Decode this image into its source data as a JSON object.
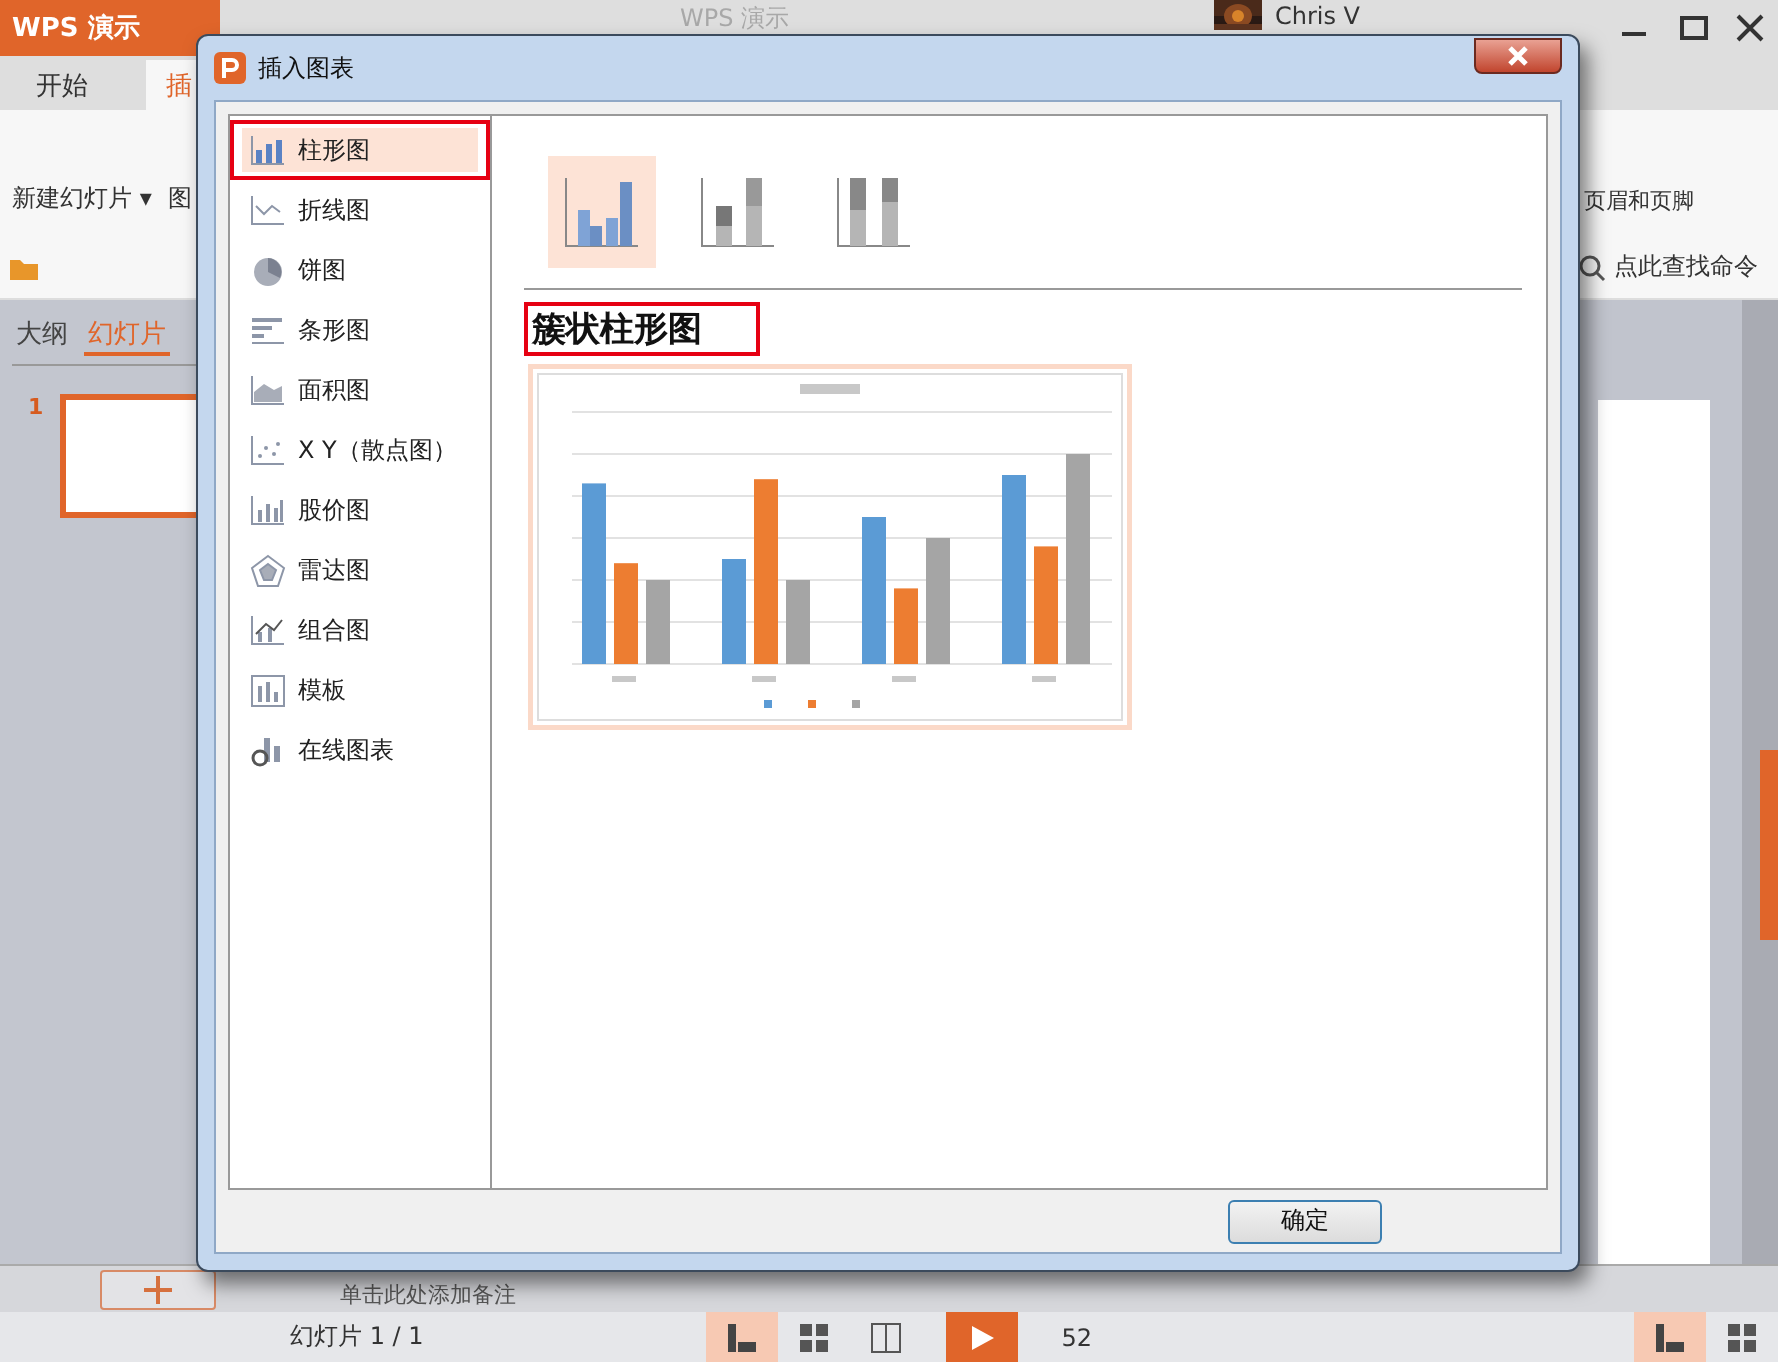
{
  "app": {
    "logo": "WPS 演示",
    "title": "WPS 演示",
    "user": "Chris V"
  },
  "ribbon_tabs": [
    {
      "label": "开始",
      "selected": false
    },
    {
      "label": "插",
      "selected": true
    }
  ],
  "ribbon": {
    "new_slide": "新建幻灯片",
    "new_slide_caret": "▾",
    "cut_button": "图",
    "header_footer": "页眉和页脚",
    "search_placeholder": "点此查找命令"
  },
  "panel_tabs": [
    {
      "label": "大纲",
      "selected": false
    },
    {
      "label": "幻灯片",
      "selected": true
    }
  ],
  "slides": [
    {
      "number": "1",
      "selected": true
    }
  ],
  "notes_placeholder": "单击此处添加备注",
  "status_bar": {
    "slide_counter": "幻灯片 1 / 1",
    "zoom": "52"
  },
  "dialog": {
    "title": "插入图表",
    "categories": [
      {
        "label": "柱形图",
        "kind": "column",
        "selected": true
      },
      {
        "label": "折线图",
        "kind": "line",
        "selected": false
      },
      {
        "label": "饼图",
        "kind": "pie",
        "selected": false
      },
      {
        "label": "条形图",
        "kind": "bar",
        "selected": false
      },
      {
        "label": "面积图",
        "kind": "area",
        "selected": false
      },
      {
        "label": "X Y（散点图）",
        "kind": "scatter",
        "selected": false
      },
      {
        "label": "股价图",
        "kind": "stock",
        "selected": false
      },
      {
        "label": "雷达图",
        "kind": "radar",
        "selected": false
      },
      {
        "label": "组合图",
        "kind": "combo",
        "selected": false
      },
      {
        "label": "模板",
        "kind": "template",
        "selected": false
      },
      {
        "label": "在线图表",
        "kind": "online",
        "selected": false
      }
    ],
    "subtypes": [
      {
        "kind": "clustered",
        "selected": true
      },
      {
        "kind": "stacked",
        "selected": false
      },
      {
        "kind": "percent",
        "selected": false
      }
    ],
    "subtype_title": "簇状柱形图",
    "ok_button": "确定"
  }
}
